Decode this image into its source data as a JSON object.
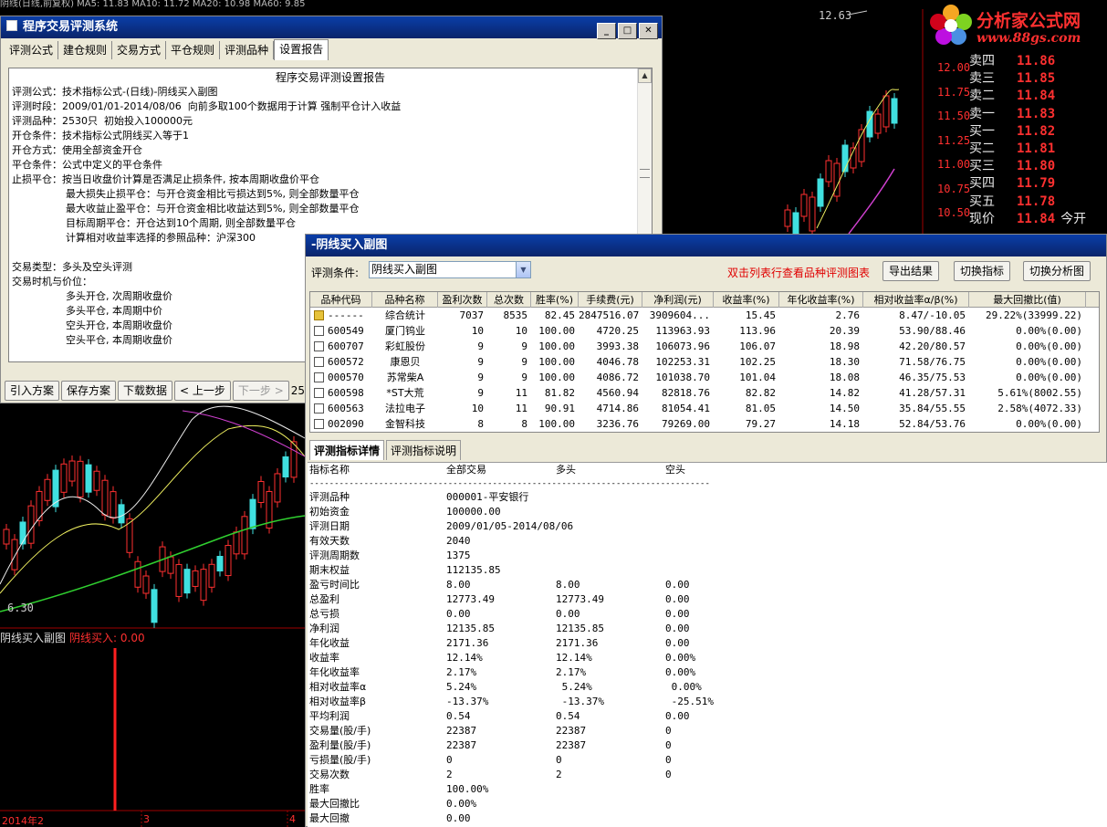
{
  "chart_header": {
    "ma_text": "阴线(日线,前复权) MA5: 11.83  MA10: 11.72  MA20: 10.98  MA60: 9.85"
  },
  "logo": {
    "title": "分析家公式网",
    "url": "www.88gs.com"
  },
  "price_axis": [
    "12.00",
    "11.75",
    "11.50",
    "11.25",
    "11.00",
    "10.75",
    "10.50"
  ],
  "peak_label": "12.63",
  "low_label": "6.30",
  "quotes": [
    {
      "label": "卖四",
      "price": "11.86"
    },
    {
      "label": "卖三",
      "price": "11.85"
    },
    {
      "label": "卖二",
      "price": "11.84"
    },
    {
      "label": "卖一",
      "price": "11.83"
    },
    {
      "label": "买一",
      "price": "11.82"
    },
    {
      "label": "买二",
      "price": "11.81"
    },
    {
      "label": "买三",
      "price": "11.80"
    },
    {
      "label": "买四",
      "price": "11.79"
    },
    {
      "label": "买五",
      "price": "11.78"
    },
    {
      "label": "现价",
      "price": "11.84",
      "extra": "今开"
    }
  ],
  "sub_chart": {
    "title": "阴线买入副图",
    "value_label": "阴线买入: 0.00"
  },
  "date_axis": [
    "2014年2",
    "3",
    "4"
  ],
  "win1": {
    "title": "程序交易评测系统",
    "tabs": [
      "评测公式",
      "建仓规则",
      "交易方式",
      "平仓规则",
      "评测品种",
      "设置报告"
    ],
    "report_title": "程序交易评测设置报告",
    "report_lines": [
      {
        "text": "评测公式：技术指标公式-(日线)-阴线买入副图",
        "indent": false
      },
      {
        "text": "评测时段：2009/01/01-2014/08/06  向前多取100个数据用于计算 强制平仓计入收益",
        "indent": false
      },
      {
        "text": "评测品种：2530只  初始投入100000元",
        "indent": false
      },
      {
        "text": "开仓条件：技术指标公式阴线买入等于1",
        "indent": false
      },
      {
        "text": "开仓方式：使用全部资金开仓",
        "indent": false
      },
      {
        "text": "平仓条件：公式中定义的平仓条件",
        "indent": false
      },
      {
        "text": "止损平仓：按当日收盘价计算是否满足止损条件, 按本周期收盘价平仓",
        "indent": false
      },
      {
        "text": "最大损失止损平仓：与开仓资金相比亏损达到5%, 则全部数量平仓",
        "indent": true
      },
      {
        "text": "最大收益止盈平仓：与开仓资金相比收益达到5%, 则全部数量平仓",
        "indent": true
      },
      {
        "text": "目标周期平仓：开仓达到10个周期, 则全部数量平仓",
        "indent": true
      },
      {
        "text": "计算相对收益率选择的参照品种：沪深300",
        "indent": true
      },
      {
        "text": "",
        "indent": false
      },
      {
        "text": "交易类型：多头及空头评测",
        "indent": false
      },
      {
        "text": "交易时机与价位：",
        "indent": false
      },
      {
        "text": "多头开仓, 次周期收盘价",
        "indent": true
      },
      {
        "text": "多头平仓, 本周期中价",
        "indent": true
      },
      {
        "text": "空头开仓, 本周期收盘价",
        "indent": true
      },
      {
        "text": "空头平仓, 本周期收盘价",
        "indent": true
      }
    ],
    "buttons": [
      "引入方案",
      "保存方案",
      "下载数据",
      "< 上一步",
      "下一步 >"
    ],
    "page_num": "25"
  },
  "win2": {
    "title": "-阴线买入副图",
    "condition_label": "评测条件:",
    "condition_value": "阴线买入副图",
    "hint": "双击列表行查看品种评测图表",
    "buttons": [
      "导出结果",
      "切换指标",
      "切换分析图"
    ],
    "columns": [
      "品种代码",
      "品种名称",
      "盈利次数",
      "总次数",
      "胜率(%)",
      "手续费(元)",
      "净利润(元)",
      "收益率(%)",
      "年化收益率(%)",
      "相对收益率α/β(%)",
      "最大回撤比(值)"
    ],
    "rows": [
      [
        "------",
        "综合统计",
        "7037",
        "8535",
        "82.45",
        "2847516.07",
        "3909604...",
        "15.45",
        "2.76",
        "8.47/-10.05",
        "29.22%(33999.22)"
      ],
      [
        "600549",
        "厦门钨业",
        "10",
        "10",
        "100.00",
        "4720.25",
        "113963.93",
        "113.96",
        "20.39",
        "53.90/88.46",
        "0.00%(0.00)"
      ],
      [
        "600707",
        "彩虹股份",
        "9",
        "9",
        "100.00",
        "3993.38",
        "106073.96",
        "106.07",
        "18.98",
        "42.20/80.57",
        "0.00%(0.00)"
      ],
      [
        "600572",
        "康恩贝",
        "9",
        "9",
        "100.00",
        "4046.78",
        "102253.31",
        "102.25",
        "18.30",
        "71.58/76.75",
        "0.00%(0.00)"
      ],
      [
        "000570",
        "苏常柴A",
        "9",
        "9",
        "100.00",
        "4086.72",
        "101038.70",
        "101.04",
        "18.08",
        "46.35/75.53",
        "0.00%(0.00)"
      ],
      [
        "600598",
        "*ST大荒",
        "9",
        "11",
        "81.82",
        "4560.94",
        "82818.76",
        "82.82",
        "14.82",
        "41.28/57.31",
        "5.61%(8002.55)"
      ],
      [
        "600563",
        "法拉电子",
        "10",
        "11",
        "90.91",
        "4714.86",
        "81054.41",
        "81.05",
        "14.50",
        "35.84/55.55",
        "2.58%(4072.33)"
      ],
      [
        "002090",
        "金智科技",
        "8",
        "8",
        "100.00",
        "3236.76",
        "79269.00",
        "79.27",
        "14.18",
        "52.84/53.76",
        "0.00%(0.00)"
      ]
    ],
    "detail_tabs": [
      "评测指标详情",
      "评测指标说明"
    ],
    "detail_header": [
      "指标名称",
      "全部交易",
      "多头",
      "空头"
    ],
    "detail_dashes": "-------------------------------------------------------------------------------------------------------",
    "detail_rows": [
      [
        "评测品种",
        "000001-平安银行",
        "",
        ""
      ],
      [
        "初始资金",
        "100000.00",
        "",
        ""
      ],
      [
        "评测日期",
        "2009/01/05-2014/08/06",
        "",
        ""
      ],
      [
        "有效天数",
        "2040",
        "",
        ""
      ],
      [
        "评测周期数",
        "1375",
        "",
        ""
      ],
      [
        "期末权益",
        "112135.85",
        "",
        ""
      ],
      [
        "盈亏时间比",
        "8.00",
        "8.00",
        "0.00"
      ],
      [
        "总盈利",
        "12773.49",
        "12773.49",
        "0.00"
      ],
      [
        "总亏损",
        "0.00",
        "0.00",
        "0.00"
      ],
      [
        "净利润",
        "12135.85",
        "12135.85",
        "0.00"
      ],
      [
        "年化收益",
        "2171.36",
        "2171.36",
        "0.00"
      ],
      [
        "收益率",
        "12.14%",
        "12.14%",
        "0.00%"
      ],
      [
        "年化收益率",
        "2.17%",
        "2.17%",
        "0.00%"
      ],
      [
        "相对收益率α",
        "5.24%",
        " 5.24%",
        " 0.00%"
      ],
      [
        "相对收益率β",
        "-13.37%",
        " -13.37%",
        " -25.51%"
      ],
      [
        "平均利润",
        "0.54",
        "0.54",
        "0.00"
      ],
      [
        "交易量(股/手)",
        "22387",
        "22387",
        "0"
      ],
      [
        "盈利量(股/手)",
        "22387",
        "22387",
        "0"
      ],
      [
        "亏损量(股/手)",
        "0",
        "0",
        "0"
      ],
      [
        "交易次数",
        "2",
        "2",
        "0"
      ],
      [
        "胜率",
        "100.00%",
        "",
        ""
      ],
      [
        "最大回撤比",
        "0.00%",
        "",
        ""
      ],
      [
        "最大回撤",
        "0.00",
        "",
        ""
      ]
    ]
  }
}
